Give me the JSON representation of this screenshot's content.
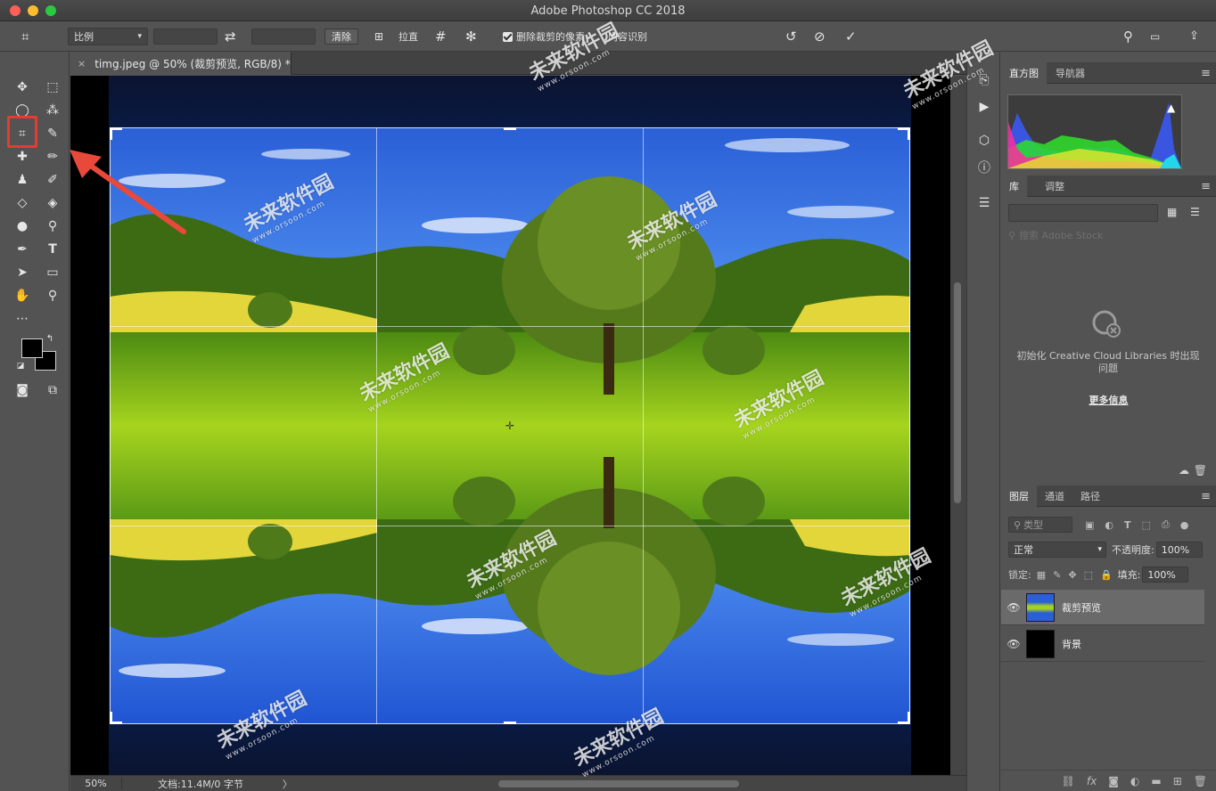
{
  "window": {
    "title": "Adobe Photoshop CC 2018"
  },
  "options_bar": {
    "ratio_select": "比例",
    "clear_button": "清除",
    "straighten_label": "拉直",
    "delete_cropped_label": "删除裁剪的像素",
    "content_aware_label": "内容识别"
  },
  "document": {
    "tab_label": "timg.jpeg @ 50% (裁剪预览, RGB/8) *",
    "close_glyph": "×"
  },
  "status": {
    "zoom": "50%",
    "doc_info": "文档:11.4M/0 字节",
    "arrow": "〉"
  },
  "histogram_panel": {
    "tabs": [
      "直方图",
      "导航器"
    ]
  },
  "library_panel": {
    "tabs": [
      "库",
      "调整"
    ],
    "search_placeholder": "搜索 Adobe Stock",
    "message": "初始化 Creative Cloud Libraries 时出现问题",
    "link": "更多信息"
  },
  "layers_panel": {
    "tabs": [
      "图层",
      "通道",
      "路径"
    ],
    "filter_label": "类型",
    "blend_mode": "正常",
    "opacity_label": "不透明度:",
    "opacity_value": "100%",
    "lock_label": "锁定:",
    "fill_label": "填充:",
    "fill_value": "100%",
    "layers": [
      {
        "name": "裁剪预览",
        "selected": true
      },
      {
        "name": "背景",
        "selected": false
      }
    ]
  },
  "watermark": {
    "brand": "未来软件园",
    "url": "www.orsoon.com"
  },
  "colors": {
    "highlight": "#e53c2f",
    "sky": "#1e56d8",
    "grass": "#7fbf1a"
  }
}
